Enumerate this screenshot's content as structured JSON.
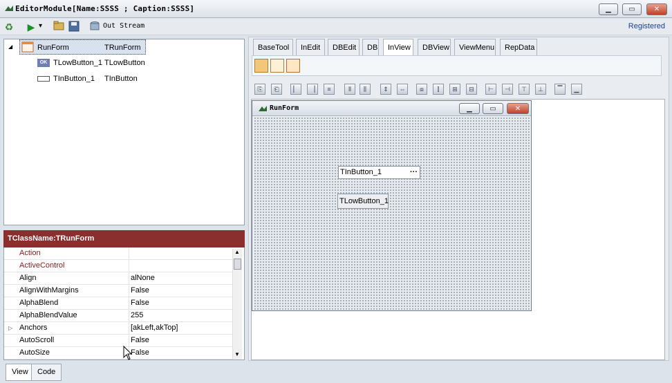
{
  "window": {
    "title": "EditorModule[Name:SSSS ; Caption:SSSS]",
    "min_glyph": "▁",
    "max_glyph": "▭",
    "close_glyph": "✕"
  },
  "toolbar": {
    "out_stream_label": "Out Stream",
    "registered_label": "Registered",
    "dropdown_glyph": "▾"
  },
  "tree": {
    "expand_glyph": "◢",
    "nodes": [
      {
        "name": "RunForm",
        "class": "TRunForm",
        "icon": "form-icon"
      },
      {
        "name": "TLowButton_1",
        "class": "TLowButton",
        "icon": "ok-button-icon",
        "icon_text": "OK"
      },
      {
        "name": "TInButton_1",
        "class": "TInButton",
        "icon": "edit-field-icon"
      }
    ]
  },
  "properties": {
    "header": "TClassName:TRunForm",
    "rows": [
      {
        "name": "Action",
        "value": "",
        "highlight": true
      },
      {
        "name": "ActiveControl",
        "value": "",
        "highlight": true
      },
      {
        "name": "Align",
        "value": "alNone"
      },
      {
        "name": "AlignWithMargins",
        "value": "False"
      },
      {
        "name": "AlphaBlend",
        "value": "False"
      },
      {
        "name": "AlphaBlendValue",
        "value": "255"
      },
      {
        "name": "Anchors",
        "value": "[akLeft,akTop]",
        "expandable": true
      },
      {
        "name": "AutoScroll",
        "value": "False"
      },
      {
        "name": "AutoSize",
        "value": "False"
      }
    ]
  },
  "bottom_tabs": [
    "View",
    "Code"
  ],
  "palette_tabs": [
    "BaseTool",
    "InEdit",
    "DBEdit",
    "DB",
    "InView",
    "DBView",
    "ViewMenu",
    "RepData"
  ],
  "active_palette_tab": "InView",
  "runform": {
    "title": "RunForm",
    "inbutton_label": "TInButton_1",
    "inbutton_ellipsis": "···",
    "lowbutton_label": "TLowButton_1"
  },
  "colors": {
    "prop_header_bg": "#8b2e2e",
    "highlight_text": "#8b1a1a",
    "registered_text": "#1b3f96"
  }
}
